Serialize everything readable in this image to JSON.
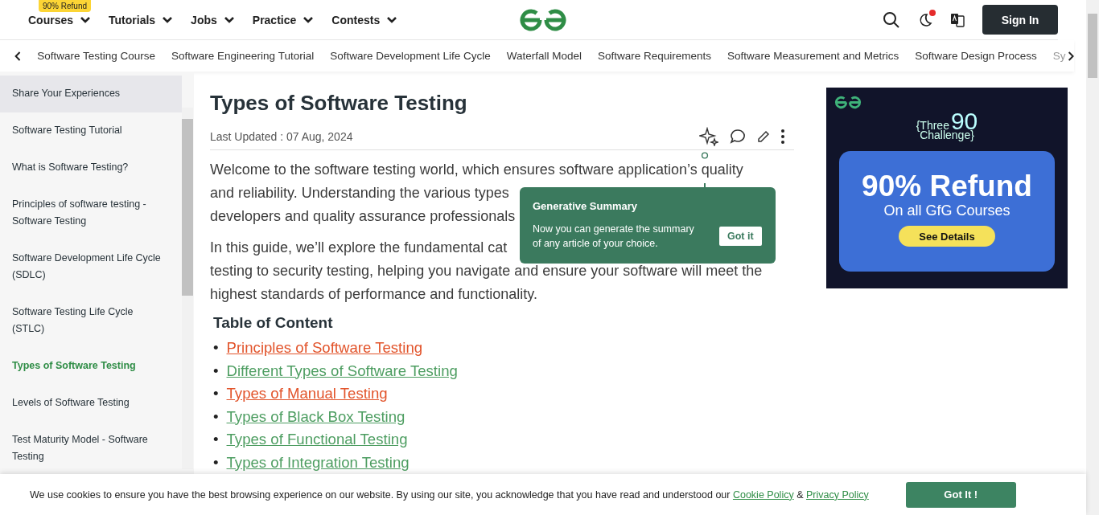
{
  "header": {
    "badge": "90% Refund",
    "menu": [
      {
        "label": "Courses"
      },
      {
        "label": "Tutorials"
      },
      {
        "label": "Jobs"
      },
      {
        "label": "Practice"
      },
      {
        "label": "Contests"
      }
    ],
    "notification": true,
    "sign_in": "Sign In"
  },
  "subnav": [
    "Software Testing Course",
    "Software Engineering Tutorial",
    "Software Development Life Cycle",
    "Waterfall Model",
    "Software Requirements",
    "Software Measurement and Metrics",
    "Software Design Process",
    "Sy"
  ],
  "sidebar": [
    {
      "label": "Share Your Experiences",
      "highlighted": true,
      "selected": false
    },
    {
      "label": "Software Testing Tutorial",
      "highlighted": false,
      "selected": false
    },
    {
      "label": "What is Software Testing?",
      "highlighted": false,
      "selected": false
    },
    {
      "label": "Principles of software testing - Software Testing",
      "highlighted": false,
      "selected": false
    },
    {
      "label": "Software Development Life Cycle (SDLC)",
      "highlighted": false,
      "selected": false
    },
    {
      "label": "Software Testing Life Cycle (STLC)",
      "highlighted": false,
      "selected": false
    },
    {
      "label": "Types of Software Testing",
      "highlighted": false,
      "selected": true
    },
    {
      "label": "Levels of Software Testing",
      "highlighted": false,
      "selected": false
    },
    {
      "label": "Test Maturity Model - Software Testing",
      "highlighted": false,
      "selected": false
    }
  ],
  "article": {
    "title": "Types of Software Testing",
    "updated": "Last Updated : 07 Aug, 2024",
    "paragraphs": [
      [
        "Welcome to the software testing world, which ensures software application’s quality",
        "and reliability. Understanding the various types",
        "developers and quality assurance professionals"
      ],
      [
        "In this guide, we’ll explore the fundamental cat",
        "testing to security testing, helping you navigate and ensure your software will meet the",
        "highest standards of performance and functionality."
      ]
    ],
    "toc_title": "Table of Content",
    "bullet": "•",
    "toc": [
      {
        "label": "Principles of Software Testing",
        "visited": true
      },
      {
        "label": "Different Types of Software Testing",
        "visited": false
      },
      {
        "label": "Types of Manual Testing",
        "visited": true
      },
      {
        "label": "Types of Black Box Testing",
        "visited": false
      },
      {
        "label": "Types of Functional Testing",
        "visited": false
      },
      {
        "label": "Types of Integration Testing",
        "visited": false
      }
    ]
  },
  "tooltip": {
    "title": "Generative Summary",
    "text": "Now you can generate the summary of any article of your choice.",
    "button": "Got it"
  },
  "ad": {
    "tag_1": "{Three",
    "tag_2": "90",
    "tag_3": "Challenge}",
    "headline": "90% Refund",
    "subline": "On all GfG Courses",
    "button": "See Details"
  },
  "cookie": {
    "text": "We use cookies to ensure you have the best browsing experience on our website. By using our site, you acknowledge that you have read and understood our",
    "link_1": "Cookie Policy",
    "amp": "&",
    "link_2": "Privacy Policy",
    "button": "Got It !"
  }
}
